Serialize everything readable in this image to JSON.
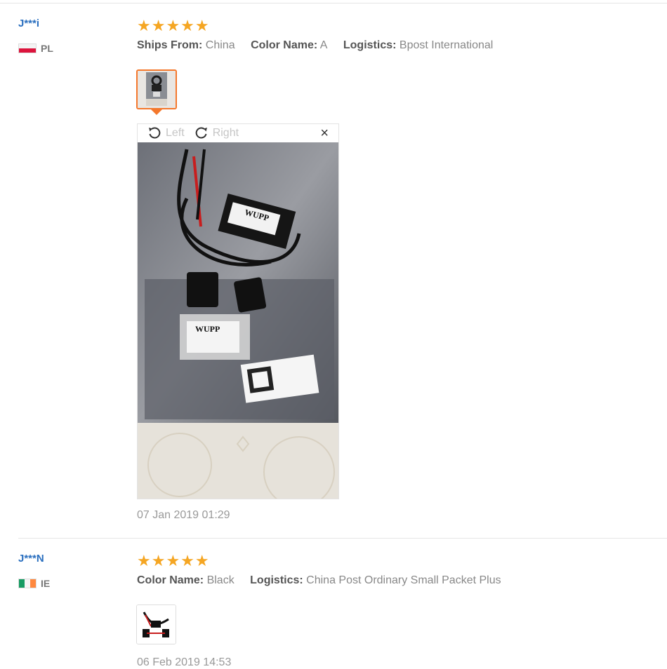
{
  "reviews": [
    {
      "user": "J***i",
      "country": "PL",
      "rating": "★★★★★",
      "meta": [
        {
          "key": "Ships From:",
          "value": "China"
        },
        {
          "key": "Color Name:",
          "value": "A"
        },
        {
          "key": "Logistics:",
          "value": "Bpost International"
        }
      ],
      "viewer": {
        "left_label": "Left",
        "right_label": "Right",
        "close": "×"
      },
      "date": "07 Jan 2019 01:29"
    },
    {
      "user": "J***N",
      "country": "IE",
      "rating": "★★★★★",
      "meta": [
        {
          "key": "Color Name:",
          "value": "Black"
        },
        {
          "key": "Logistics:",
          "value": "China Post Ordinary Small Packet Plus"
        }
      ],
      "date": "06 Feb 2019 14:53"
    }
  ],
  "product_labels": {
    "brand": "WUPP"
  },
  "colors": {
    "star": "#f5a623",
    "link": "#2a6fbf",
    "accent": "#f4782c"
  }
}
